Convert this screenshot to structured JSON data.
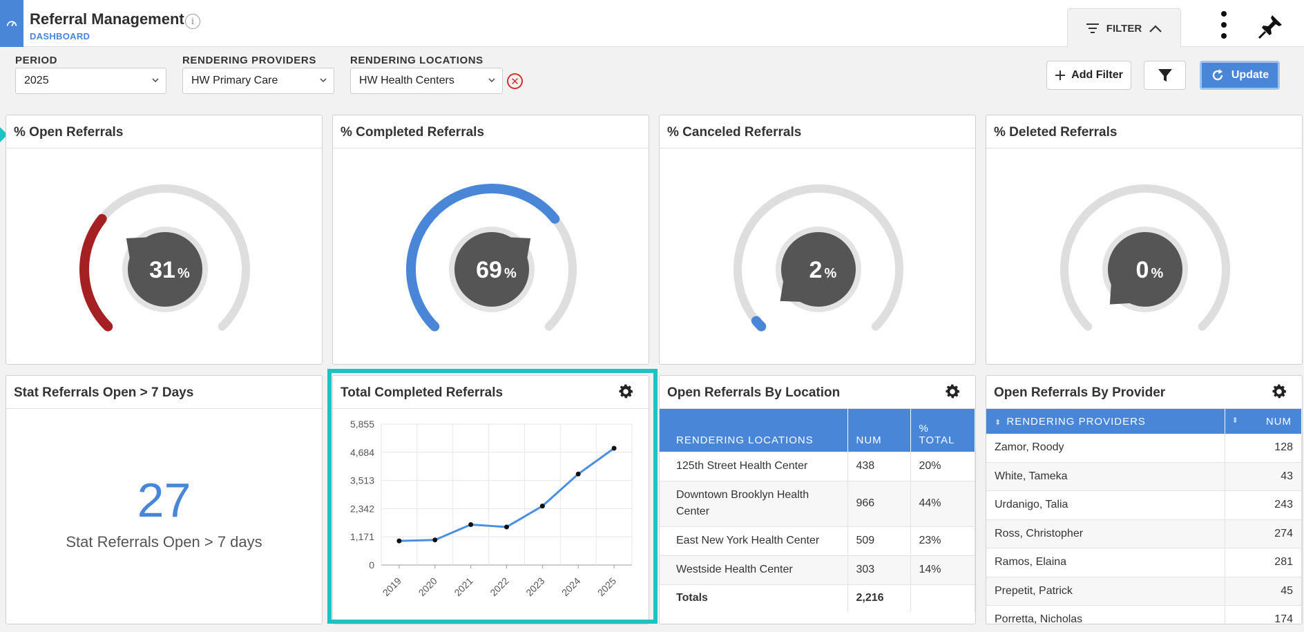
{
  "header": {
    "title": "Referral Management",
    "subtitle": "DASHBOARD",
    "filter_label": "FILTER"
  },
  "filters": {
    "period": {
      "label": "PERIOD",
      "value": "2025"
    },
    "providers": {
      "label": "RENDERING PROVIDERS",
      "value": "HW Primary Care"
    },
    "locations": {
      "label": "RENDERING LOCATIONS",
      "value": "HW Health Centers"
    },
    "add_filter_label": "Add Filter",
    "update_label": "Update"
  },
  "gauges": [
    {
      "title": "% Open Referrals",
      "value": "31",
      "unit": "%",
      "fraction": 0.31,
      "color": "#a52023"
    },
    {
      "title": "% Completed Referrals",
      "value": "69",
      "unit": "%",
      "fraction": 0.69,
      "color": "#4a86d8"
    },
    {
      "title": "% Canceled Referrals",
      "value": "2",
      "unit": "%",
      "fraction": 0.02,
      "color": "#4a86d8"
    },
    {
      "title": "% Deleted Referrals",
      "value": "0",
      "unit": "%",
      "fraction": 0.0,
      "color": "#4a86d8"
    }
  ],
  "stat_card": {
    "title": "Stat Referrals Open > 7 Days",
    "value": "27",
    "caption": "Stat Referrals Open > 7 days"
  },
  "completed_chart": {
    "title": "Total Completed Referrals"
  },
  "chart_data": {
    "type": "line",
    "title": "Total Completed Referrals",
    "categories": [
      "2019",
      "2020",
      "2021",
      "2022",
      "2023",
      "2024",
      "2025"
    ],
    "values": [
      1000,
      1040,
      1680,
      1580,
      2450,
      3780,
      4850
    ],
    "yticks": [
      "5,855",
      "4,684",
      "3,513",
      "2,342",
      "1,171",
      "0"
    ],
    "ylim": [
      0,
      5855
    ],
    "grid": true,
    "color": "#4a90e2"
  },
  "by_location": {
    "title": "Open Referrals By Location",
    "headers": [
      "RENDERING LOCATIONS",
      "NUM",
      "% TOTAL"
    ],
    "rows": [
      {
        "name": "125th Street Health Center",
        "num": "438",
        "pct": "20%"
      },
      {
        "name": "Downtown Brooklyn Health Center",
        "num": "966",
        "pct": "44%"
      },
      {
        "name": "East New York Health Center",
        "num": "509",
        "pct": "23%"
      },
      {
        "name": "Westside Health Center",
        "num": "303",
        "pct": "14%"
      }
    ],
    "totals_label": "Totals",
    "totals_num": "2,216"
  },
  "by_provider": {
    "title": "Open Referrals By Provider",
    "headers": [
      "RENDERING PROVIDERS",
      "NUM"
    ],
    "rows": [
      {
        "name": "Zamor, Roody",
        "num": "128"
      },
      {
        "name": "White, Tameka",
        "num": "43"
      },
      {
        "name": "Urdanigo, Talia",
        "num": "243"
      },
      {
        "name": "Ross, Christopher",
        "num": "274"
      },
      {
        "name": "Ramos, Elaina",
        "num": "281"
      },
      {
        "name": "Prepetit, Patrick",
        "num": "45"
      },
      {
        "name": "Porretta, Nicholas",
        "num": "174"
      }
    ]
  }
}
